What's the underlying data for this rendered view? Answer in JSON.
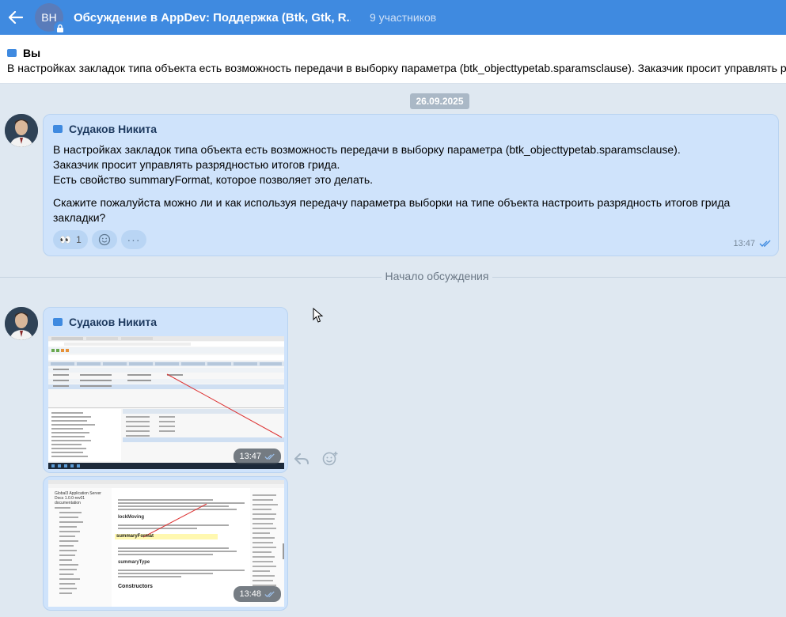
{
  "header": {
    "avatar_initials": "ВН",
    "title": "Обсуждение в AppDev: Поддержка (Btk, Gtk, R...",
    "participants": "9 участников",
    "accent": "#3f8ae0",
    "icons": [
      "back-arrow-icon",
      "lock-icon"
    ]
  },
  "pinned": {
    "author": "Вы",
    "text": "В настройках закладок типа объекта есть возможность передачи в выборку параметра (btk_objecttypetab.sparamsclause). Заказчик просит управлять р"
  },
  "feed": {
    "date": "26.09.2025",
    "divider_label": "Начало обсуждения"
  },
  "message1": {
    "author": "Судаков Никита",
    "lines": [
      "В настройках закладок типа объекта есть возможность передачи в выборку параметра (btk_objecttypetab.sparamsclause).",
      "Заказчик просит управлять разрядностью итогов грида.",
      "Есть свойство summaryFormat, которое позволяет это делать.",
      "Скажите пожалуйста можно ли и как используя передачу параметра выборки на типе объекта настроить разрядность итогов грида",
      "закладки?"
    ],
    "reaction_emoji": "👀",
    "reaction_count": "1",
    "more_label": "···",
    "time": "13:47"
  },
  "message2": {
    "author": "Судаков Никита",
    "image1_time": "13:47",
    "image2_time": "13:48",
    "doc_preview": {
      "sidebar_title": "Global3 Application Server Docs 1.0.0-rev01 documentation",
      "heading1": "lockMoving",
      "highlight": "summaryFormat",
      "heading2": "summaryType",
      "heading3": "Constructors"
    }
  }
}
